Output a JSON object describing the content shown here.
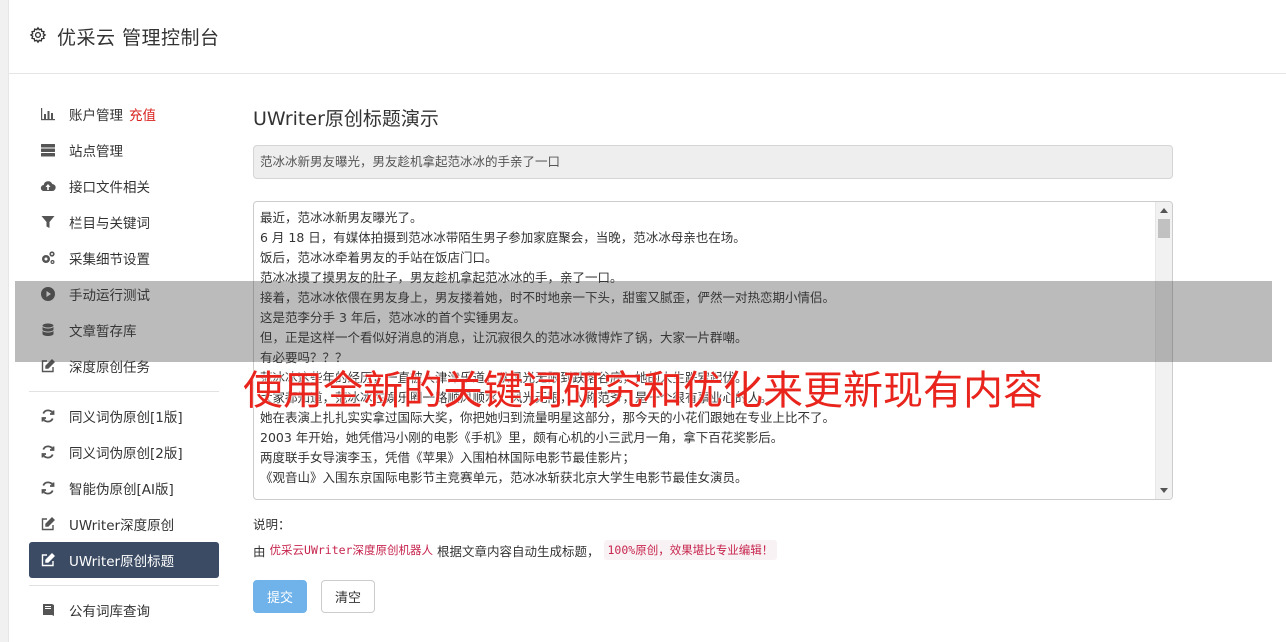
{
  "header": {
    "title": "优采云 管理控制台"
  },
  "sidebar": {
    "group1": [
      {
        "label": "账户管理",
        "badge": "充值",
        "icon": "bar-chart-icon"
      },
      {
        "label": "站点管理",
        "icon": "server-icon"
      },
      {
        "label": "接口文件相关",
        "icon": "cloud-upload-icon"
      },
      {
        "label": "栏目与关键词",
        "icon": "filter-icon"
      },
      {
        "label": "采集细节设置",
        "icon": "cogs-icon"
      },
      {
        "label": "手动运行测试",
        "icon": "play-circle-icon"
      },
      {
        "label": "文章暂存库",
        "icon": "database-icon"
      },
      {
        "label": "深度原创任务",
        "icon": "edit-icon"
      }
    ],
    "group2": [
      {
        "label": "同义词伪原创[1版]",
        "icon": "refresh-icon"
      },
      {
        "label": "同义词伪原创[2版]",
        "icon": "refresh-icon"
      },
      {
        "label": "智能伪原创[AI版]",
        "icon": "refresh-icon"
      },
      {
        "label": "UWriter深度原创",
        "icon": "edit-icon"
      },
      {
        "label": "UWriter原创标题",
        "icon": "edit-icon",
        "active": true
      }
    ],
    "group3": [
      {
        "label": "公有词库查询",
        "icon": "book-icon"
      }
    ]
  },
  "main": {
    "title": "UWriter原创标题演示",
    "generated_title": "范冰冰新男友曝光，男友趁机拿起范冰冰的手亲了一口",
    "content_lines": [
      "最近，范冰冰新男友曝光了。",
      "6 月 18 日，有媒体拍摄到范冰冰带陌生男子参加家庭聚会，当晚，范冰冰母亲也在场。",
      "饭后，范冰冰牵着男友的手站在饭店门口。",
      "范冰冰摸了摸男友的肚子，男友趁机拿起范冰冰的手，亲了一口。",
      "接着，范冰冰依偎在男友身上，男友搂着她，时不时地亲一下头，甜蜜又腻歪，俨然一对热恋期小情侣。",
      "这是范李分手 3 年后，范冰冰的首个实锤男友。",
      "但，正是这样一个看似好消息的消息，让沉寂很久的范冰冰微博炸了锅，大家一片群嘲。",
      "有必要吗？？？",
      "范冰冰这些年的经历，一直被人津津乐道，从风光无限到跌落谷底，她的人生跌宕起伏。",
      "大家都知道，范冰冰在娱乐圈一路顺风顺水，风光无限，人称范爷，是一个很有事业心的人。",
      "她在表演上扎扎实实拿过国际大奖，你把她归到流量明星这部分，那今天的小花们跟她在专业上比不了。",
      "2003 年开始，她凭借冯小刚的电影《手机》里，颇有心机的小三武月一角，拿下百花奖影后。",
      "两度联手女导演李玉，凭借《苹果》入围柏林国际电影节最佳影片；",
      "《观音山》入围东京国际电影节主竞赛单元，范冰冰斩获北京大学生电影节最佳女演员。"
    ],
    "note_label": "说明：",
    "note_prefix": "由",
    "note_accent": "优采云UWriter深度原创机器人",
    "note_middle": "根据文章内容自动生成标题，",
    "note_code": "100%原创，效果堪比专业编辑！",
    "submit_label": "提交",
    "clear_label": "清空"
  },
  "overlay": {
    "text": "使用全新的关键词研究和优化来更新现有内容"
  }
}
